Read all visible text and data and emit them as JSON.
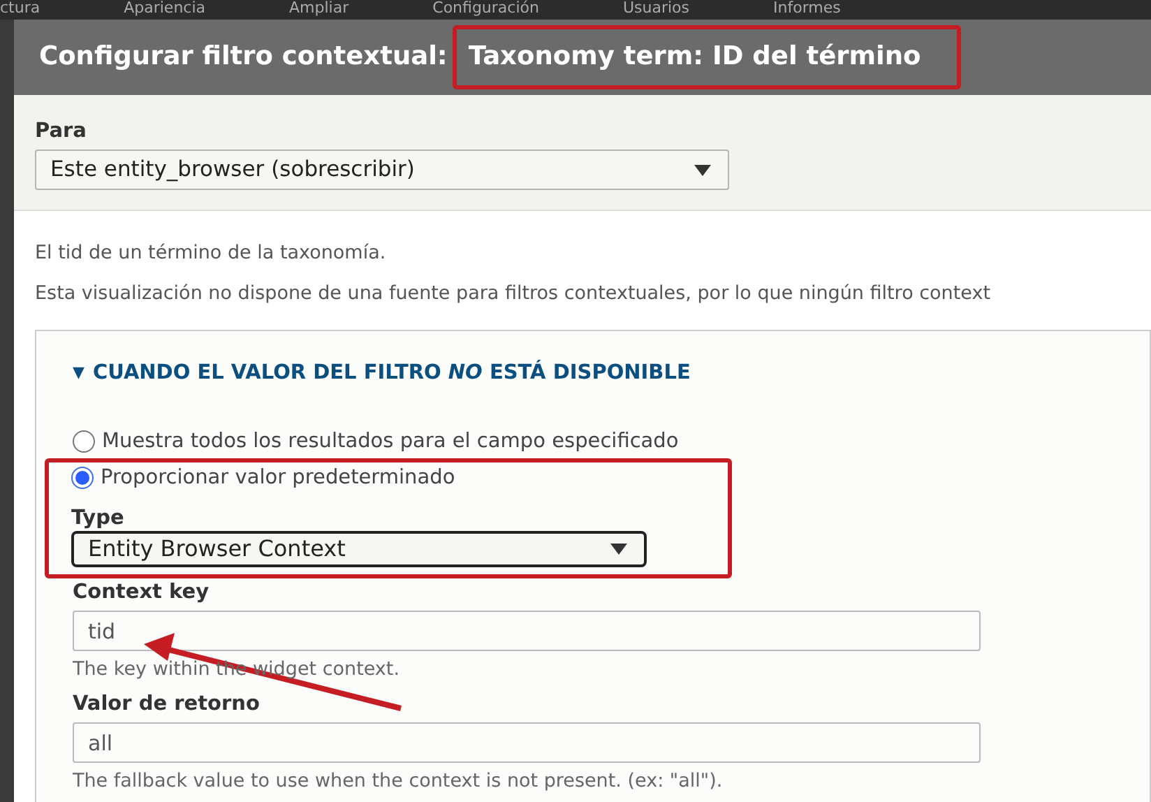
{
  "toolbar": {
    "items": [
      "ctura",
      "Apariencia",
      "Ampliar",
      "Configuración",
      "Usuarios",
      "Informes"
    ]
  },
  "dialog": {
    "title_prefix": "Configurar filtro contextual:",
    "title_subject": "Taxonomy term: ID del término",
    "for": {
      "label": "Para",
      "value": "Este entity_browser (sobrescribir)"
    },
    "descriptions": [
      "El tid de un término de la taxonomía.",
      "Esta visualización no dispone de una fuente para filtros contextuales, por lo que ningún filtro context"
    ],
    "fieldset": {
      "toggle": "▼",
      "legend": "CUANDO EL VALOR DEL FILTRO *NO* ESTÁ DISPONIBLE",
      "expanded": true,
      "options": [
        {
          "label": "Muestra todos los resultados para el campo especificado",
          "selected": false
        },
        {
          "label": "Proporcionar valor predeterminado",
          "selected": true
        }
      ],
      "type": {
        "label": "Type",
        "value": "Entity Browser Context"
      },
      "fields": [
        {
          "label": "Context key",
          "value": "tid",
          "help": "The key within the widget context."
        },
        {
          "label": "Valor de retorno",
          "value": "all",
          "help": "The fallback value to use when the context is not present. (ex: \"all\")."
        }
      ]
    }
  }
}
